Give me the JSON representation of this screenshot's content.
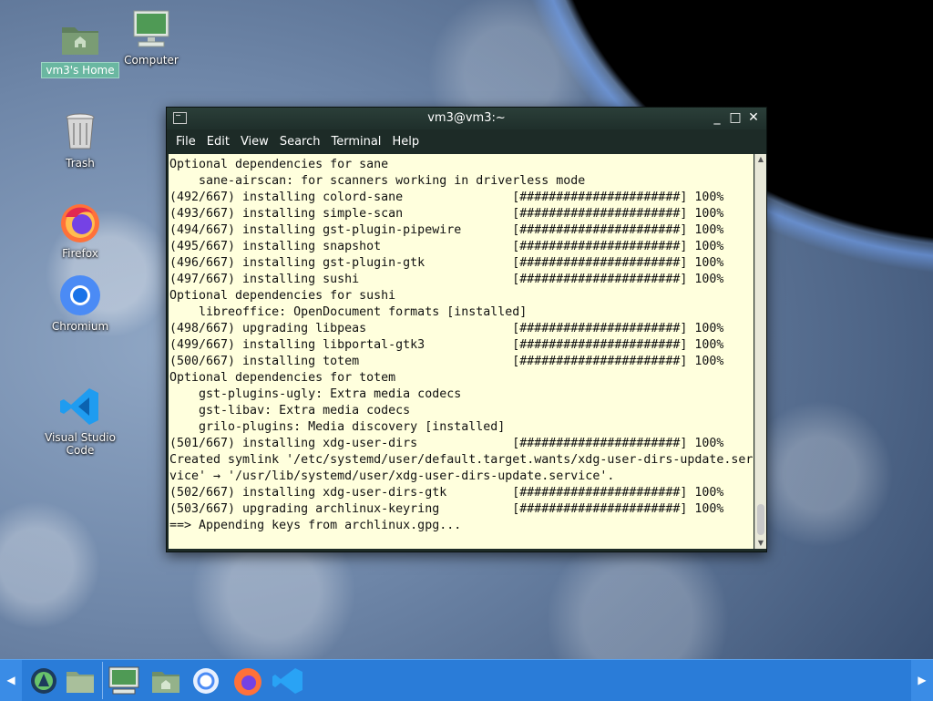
{
  "desktop": {
    "icons": [
      {
        "label": "vm3's Home",
        "icon": "folder-home-icon"
      },
      {
        "label": "Computer",
        "icon": "computer-icon"
      },
      {
        "label": "Trash",
        "icon": "trash-icon"
      },
      {
        "label": "Firefox",
        "icon": "firefox-icon"
      },
      {
        "label": "Chromium",
        "icon": "chromium-icon"
      },
      {
        "label": "Visual Studio Code",
        "icon": "vscode-icon"
      }
    ]
  },
  "terminal": {
    "title": "vm3@vm3:~",
    "window_buttons": {
      "minimize": "_",
      "maximize": "□",
      "close": "✕"
    },
    "menu": [
      "File",
      "Edit",
      "View",
      "Search",
      "Terminal",
      "Help"
    ],
    "lines": [
      "Optional dependencies for sane",
      "    sane-airscan: for scanners working in driverless mode",
      "(492/667) installing colord-sane               [######################] 100%",
      "(493/667) installing simple-scan               [######################] 100%",
      "(494/667) installing gst-plugin-pipewire       [######################] 100%",
      "(495/667) installing snapshot                  [######################] 100%",
      "(496/667) installing gst-plugin-gtk            [######################] 100%",
      "(497/667) installing sushi                     [######################] 100%",
      "Optional dependencies for sushi",
      "    libreoffice: OpenDocument formats [installed]",
      "(498/667) upgrading libpeas                    [######################] 100%",
      "(499/667) installing libportal-gtk3            [######################] 100%",
      "(500/667) installing totem                     [######################] 100%",
      "Optional dependencies for totem",
      "    gst-plugins-ugly: Extra media codecs",
      "    gst-libav: Extra media codecs",
      "    grilo-plugins: Media discovery [installed]",
      "(501/667) installing xdg-user-dirs             [######################] 100%",
      "Created symlink '/etc/systemd/user/default.target.wants/xdg-user-dirs-update.ser",
      "vice' → '/usr/lib/systemd/user/xdg-user-dirs-update.service'.",
      "(502/667) installing xdg-user-dirs-gtk         [######################] 100%",
      "(503/667) upgrading archlinux-keyring          [######################] 100%",
      "==> Appending keys from archlinux.gpg..."
    ]
  },
  "taskbar": {
    "left_arrow": "◀",
    "right_arrow": "▶",
    "items": [
      "menu-icon",
      "show-desktop-icon",
      "computer-icon",
      "home-folder-icon",
      "chromium-icon",
      "firefox-icon",
      "vscode-icon"
    ]
  },
  "colors": {
    "terminal_bg": "#ffffdd",
    "titlebar": "#1f2f2b",
    "taskbar": "#2a7cd8",
    "selected_label": "#6ab7a1"
  }
}
